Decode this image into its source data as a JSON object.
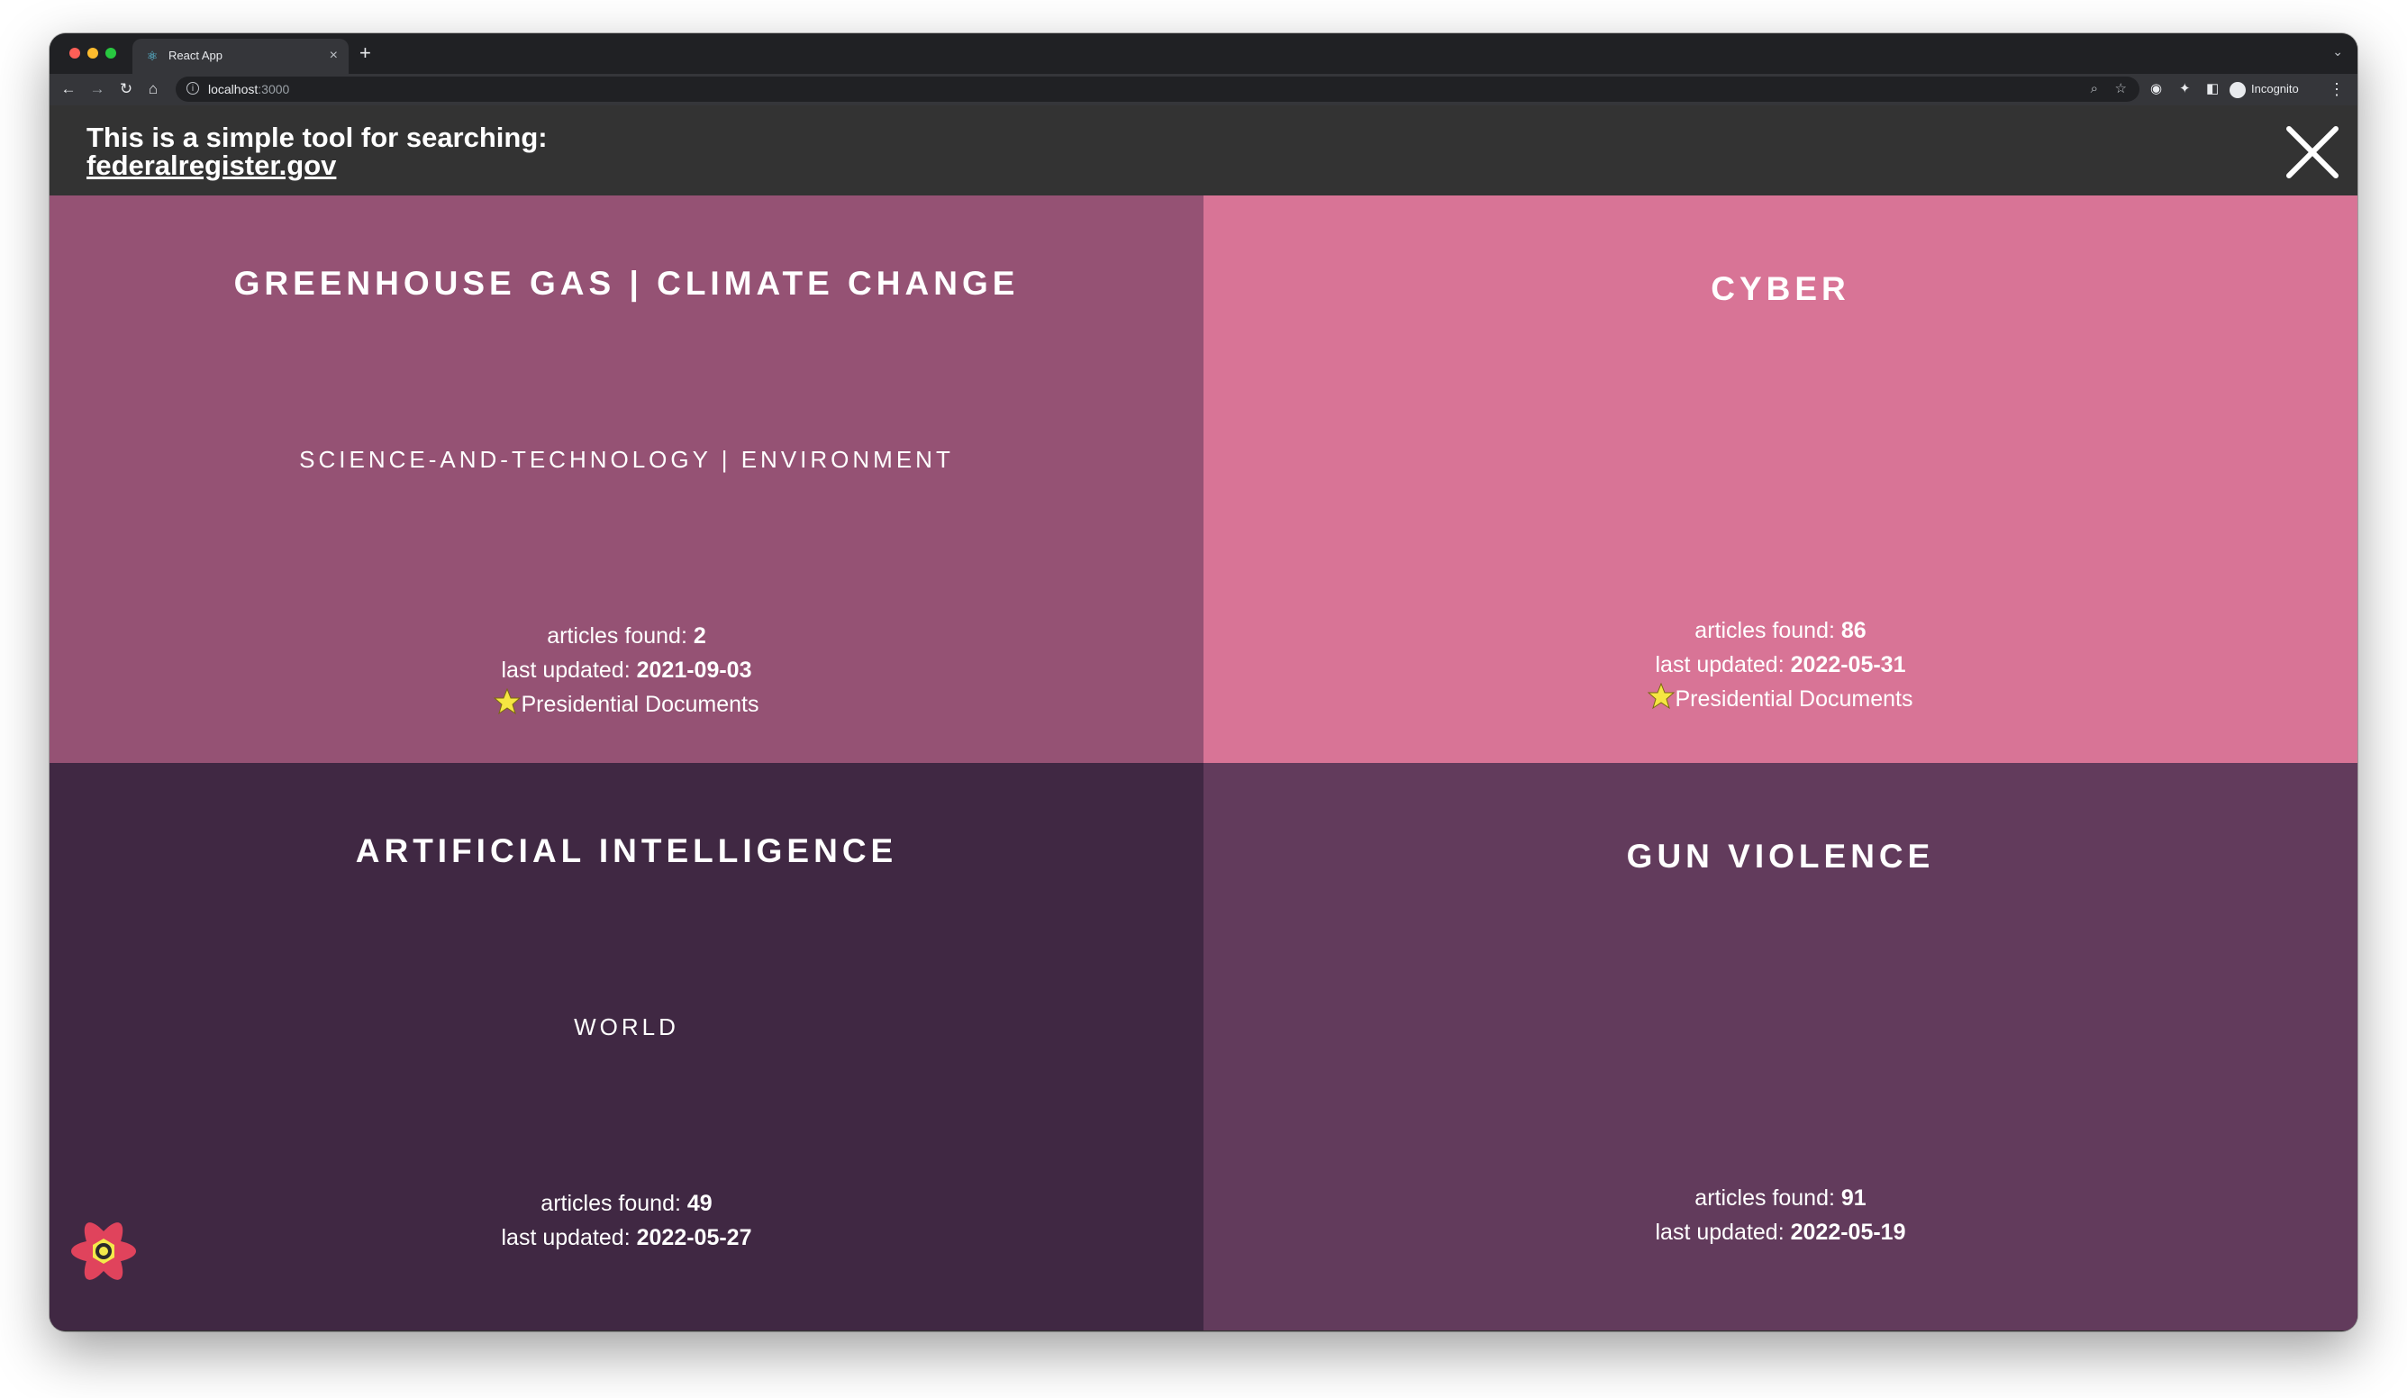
{
  "browser": {
    "tab_title": "React App",
    "tab_close": "×",
    "new_tab": "+",
    "url_host": "localhost",
    "url_port": ":3000",
    "profile_label": "Incognito"
  },
  "header": {
    "title": "This is a simple tool for searching:",
    "link_text": "federalregister.gov"
  },
  "labels": {
    "articles_found": "articles found: ",
    "last_updated": "last updated: ",
    "presidential": "Presidential Documents"
  },
  "cards": [
    {
      "title": "GREENHOUSE GAS | CLIMATE CHANGE",
      "subtitle": "SCIENCE-AND-TECHNOLOGY | ENVIRONMENT",
      "articles_found": "2",
      "last_updated": "2021-09-03",
      "presidential": true,
      "color": "#955274"
    },
    {
      "title": "CYBER",
      "subtitle": "",
      "articles_found": "86",
      "last_updated": "2022-05-31",
      "presidential": true,
      "color": "#d87496"
    },
    {
      "title": "ARTIFICIAL INTELLIGENCE",
      "subtitle": "WORLD",
      "articles_found": "49",
      "last_updated": "2022-05-27",
      "presidential": false,
      "color": "#402843"
    },
    {
      "title": "GUN VIOLENCE",
      "subtitle": "",
      "articles_found": "91",
      "last_updated": "2022-05-19",
      "presidential": false,
      "color": "#623b5c"
    }
  ],
  "colors": {
    "header_bg": "#333333",
    "star": "#f5e642",
    "react_logo": "#e0435c"
  }
}
